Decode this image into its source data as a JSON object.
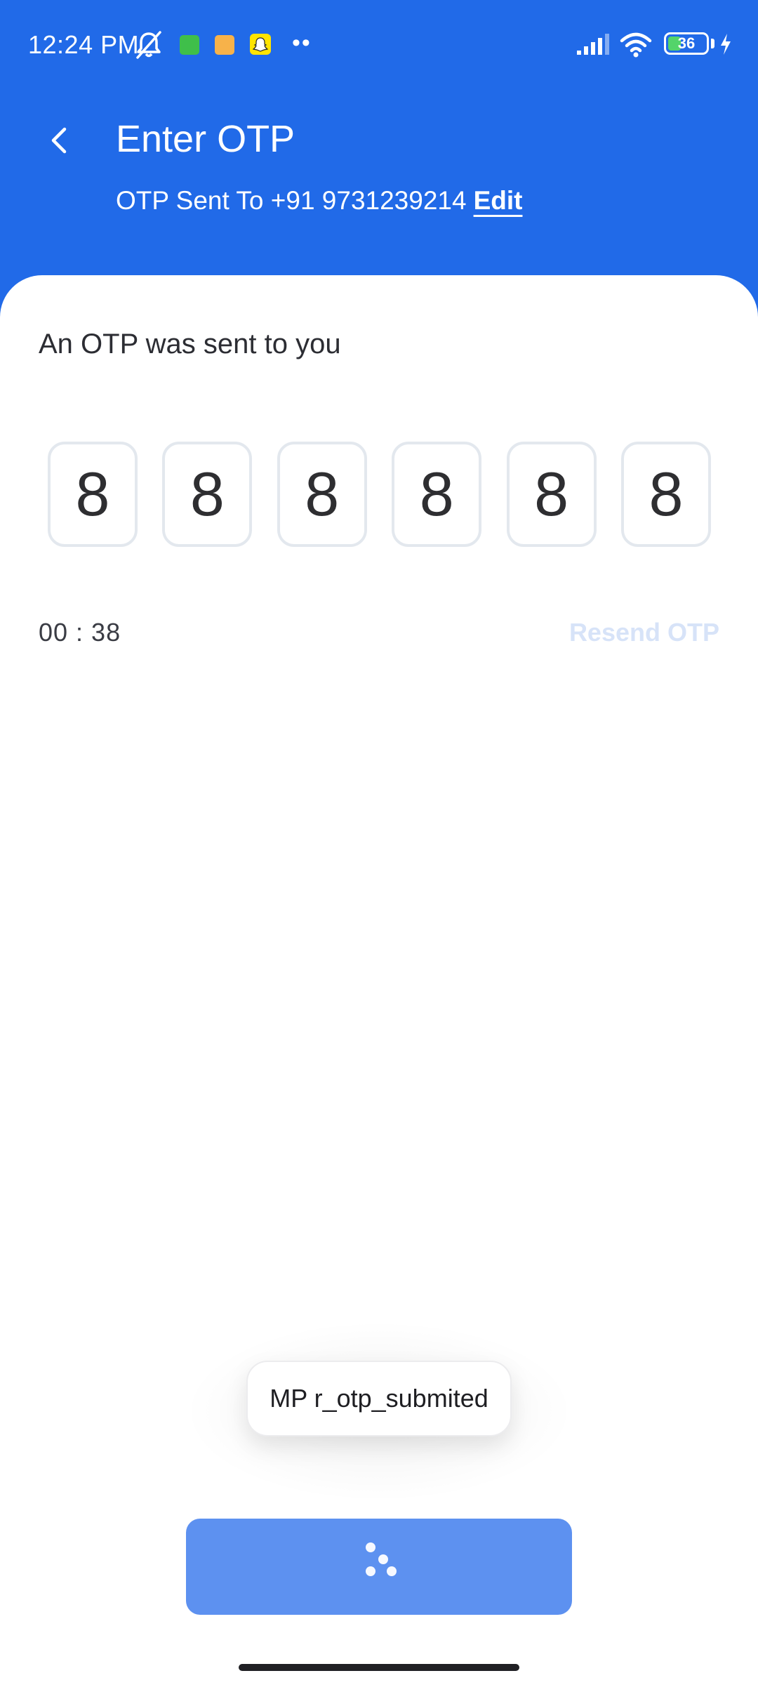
{
  "status_bar": {
    "time": "12:24 PM",
    "battery_level": "36",
    "icons": [
      "mute-icon",
      "app-notification-icon",
      "message-icon",
      "snapchat-icon",
      "more-dots-icon",
      "signal-icon",
      "wifi-icon",
      "battery-icon",
      "charging-icon"
    ],
    "more_dots": "••"
  },
  "header": {
    "back_icon": "chevron-left-icon",
    "title": "Enter OTP",
    "subtitle_prefix": "OTP Sent To +91 9731239214",
    "edit_label": "Edit"
  },
  "main": {
    "message": "An OTP was sent to you",
    "otp_digits": [
      "8",
      "8",
      "8",
      "8",
      "8",
      "8"
    ],
    "timer": "00 : 38",
    "resend_label": "Resend OTP"
  },
  "toast": {
    "text": "MP r_otp_submited"
  },
  "submit": {
    "state": "loading",
    "icon": "loading-spinner-icon"
  },
  "colors": {
    "brand_blue": "#216ae8",
    "button_blue": "#5d91f0",
    "resend_disabled": "#d7e3f8",
    "otp_border": "#e3e8ee"
  }
}
